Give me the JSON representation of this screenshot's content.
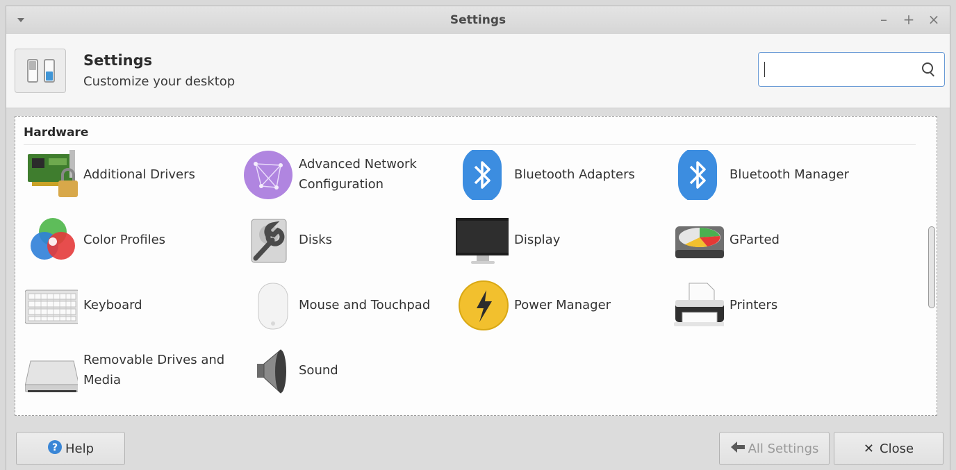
{
  "window": {
    "title": "Settings",
    "minimize": "–",
    "maximize": "+",
    "close": "×"
  },
  "header": {
    "title": "Settings",
    "subtitle": "Customize your desktop",
    "search": {
      "value": "",
      "placeholder": ""
    }
  },
  "section": {
    "title": "Hardware",
    "items": [
      {
        "label": "Additional Drivers",
        "icon": "circuit-board-lock-icon"
      },
      {
        "label": "Advanced Network Configuration",
        "icon": "network-globe-icon"
      },
      {
        "label": "Bluetooth Adapters",
        "icon": "bluetooth-icon"
      },
      {
        "label": "Bluetooth Manager",
        "icon": "bluetooth-icon"
      },
      {
        "label": "Color Profiles",
        "icon": "color-circles-icon"
      },
      {
        "label": "Disks",
        "icon": "disk-wrench-icon"
      },
      {
        "label": "Display",
        "icon": "monitor-icon"
      },
      {
        "label": "GParted",
        "icon": "hard-drive-chart-icon"
      },
      {
        "label": "Keyboard",
        "icon": "keyboard-icon"
      },
      {
        "label": "Mouse and Touchpad",
        "icon": "mouse-icon"
      },
      {
        "label": "Power Manager",
        "icon": "lightning-icon"
      },
      {
        "label": "Printers",
        "icon": "printer-icon"
      },
      {
        "label": "Removable Drives and Media",
        "icon": "removable-drive-icon"
      },
      {
        "label": "Sound",
        "icon": "speaker-icon"
      }
    ]
  },
  "footer": {
    "help": "Help",
    "all_settings": "All Settings",
    "close": "Close"
  },
  "colors": {
    "accent": "#3f95d6",
    "bluetooth": "#3c8de0",
    "power": "#f2c02e",
    "network": "#b085e0"
  }
}
